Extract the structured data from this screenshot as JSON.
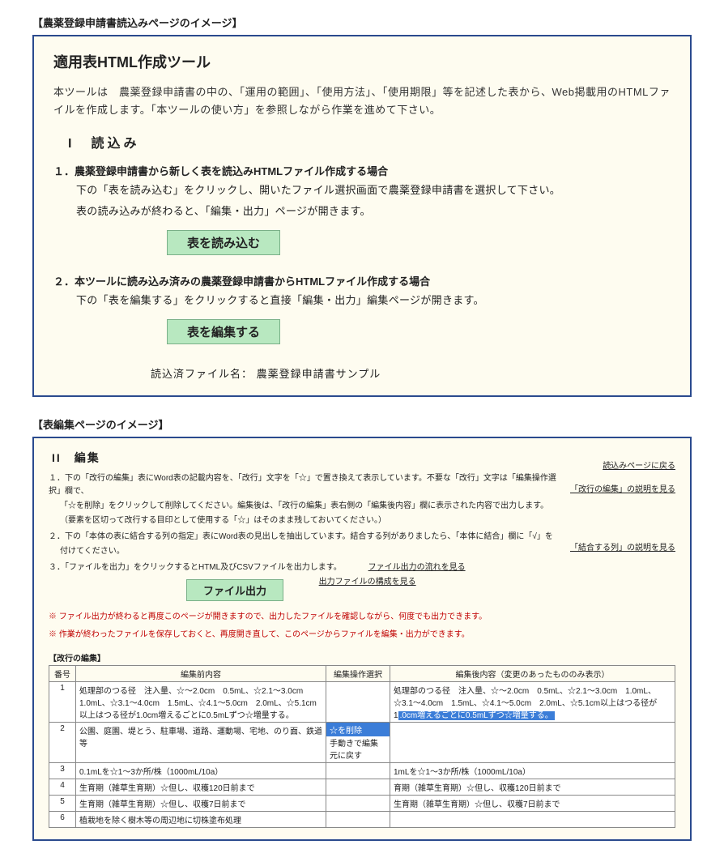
{
  "caption1": "【農薬登録申請書読込みページのイメージ】",
  "caption2": "【表編集ページのイメージ】",
  "tool": {
    "title": "適用表HTML作成ツール",
    "desc": "本ツールは　農薬登録申請書の中の、「運用の範囲」、「使用方法」、「使用期限」等を記述した表から、Web掲載用のHTMLファイルを作成します。「本ツールの使い方」を参照しながら作業を進めて下さい。",
    "sec_i": "I　読込み",
    "step1_head": "１．農薬登録申請書から新しく表を読込みHTMLファイル作成する場合",
    "step1_body1": "下の「表を読み込む」をクリックし、開いたファイル選択画面で農薬登録申請書を選択して下さい。",
    "step1_body2": "表の読み込みが終わると、「編集・出力」ページが開きます。",
    "btn_load": "表を読み込む",
    "step2_head": "２．本ツールに読み込み済みの農薬登録申請書からHTMLファイル作成する場合",
    "step2_body": "下の「表を編集する」をクリックすると直接「編集・出力」編集ページが開きます。",
    "btn_edit": "表を編集する",
    "file_label": "読込済ファイル名：",
    "file_value": "農薬登録申請書サンプル"
  },
  "edit": {
    "sec_ii": "II　編集",
    "back_link": "読込みページに戻る",
    "p1a": "１．下の「改行の編集」表にWord表の記載内容を、「改行」文字を「☆」で置き換えて表示しています。不要な「改行」文字は「編集操作選択」欄で、",
    "p1b": "「☆を削除」をクリックして削除してください。編集後は、「改行の編集」表右側の「編集後内容」欄に表示された内容で出力します。",
    "p1c": "（要素を区切って改行する目印として使用する「☆」はそのまま残しておいてください。）",
    "link1": "「改行の編集」の説明を見る",
    "p2a": "２．下の「本体の表に結合する列の指定」表にWord表の見出しを抽出しています。結合する列がありましたら、「本体に結合」欄に「√」を",
    "p2b": "付けてください。",
    "link2": "「結合する列」の説明を見る",
    "p3": "３．「ファイルを出力」をクリックするとHTML及びCSVファイルを出力します。",
    "l3a": "ファイル出力の流れを見る",
    "l3b": "出力ファイルの構成を見る",
    "btn_out": "ファイル出力",
    "note1": "※ ファイル出力が終わると再度このページが開きますので、出力したファイルを確認しながら、何度でも出力できます。",
    "note2": "※ 作業が終わったファイルを保存しておくと、再度開き直して、このページからファイルを編集・出力ができます。",
    "tbl_caption": "【改行の編集】",
    "th_num": "番号",
    "th_before": "編集前内容",
    "th_op": "編集操作選択",
    "th_after": "編集後内容（変更のあったもののみ表示）",
    "rows": [
      {
        "n": "1",
        "before": "処理部のつる径　注入量、☆〜2.0cm　0.5mL、☆2.1〜3.0cm　1.0mL、☆3.1〜4.0cm　1.5mL、☆4.1〜5.0cm　2.0mL、☆5.1cm以上はつる径が1.0cm増えるごとに0.5mLずつ☆増量する。",
        "op": "",
        "after": "処理部のつる径　注入量、☆〜2.0cm　0.5mL、☆2.1〜3.0cm　1.0mL、☆3.1〜4.0cm　1.5mL、☆4.1〜5.0cm　2.0mL、☆5.1cm以上はつる径が1",
        "after_blue": ".0cm増えるごとに0.5mLずつ☆増量する。"
      },
      {
        "n": "2",
        "before": "公園、庭園、堤とう、駐車場、道路、運動場、宅地、のり面、鉄道 等",
        "op_menu": [
          "☆を削除",
          "手動きで編集",
          "元に戻す"
        ],
        "after": ""
      },
      {
        "n": "3",
        "before": "0.1mLを☆1〜3か所/株（1000mL/10a）",
        "op": "",
        "after": "1mLを☆1〜3か所/株（1000mL/10a）"
      },
      {
        "n": "4",
        "before": "生育期（雑草生育期）☆但し、収穫120日前まで",
        "op": "",
        "after": "育期（雑草生育期）☆但し、収穫120日前まで"
      },
      {
        "n": "5",
        "before": "生育期（雑草生育期）☆但し、収穫7日前まで",
        "op": "",
        "after": "生育期（雑草生育期）☆但し、収穫7日前まで"
      },
      {
        "n": "6",
        "before": "植栽地を除く樹木等の周辺地に切株塗布処理",
        "op": "",
        "after": ""
      }
    ]
  }
}
